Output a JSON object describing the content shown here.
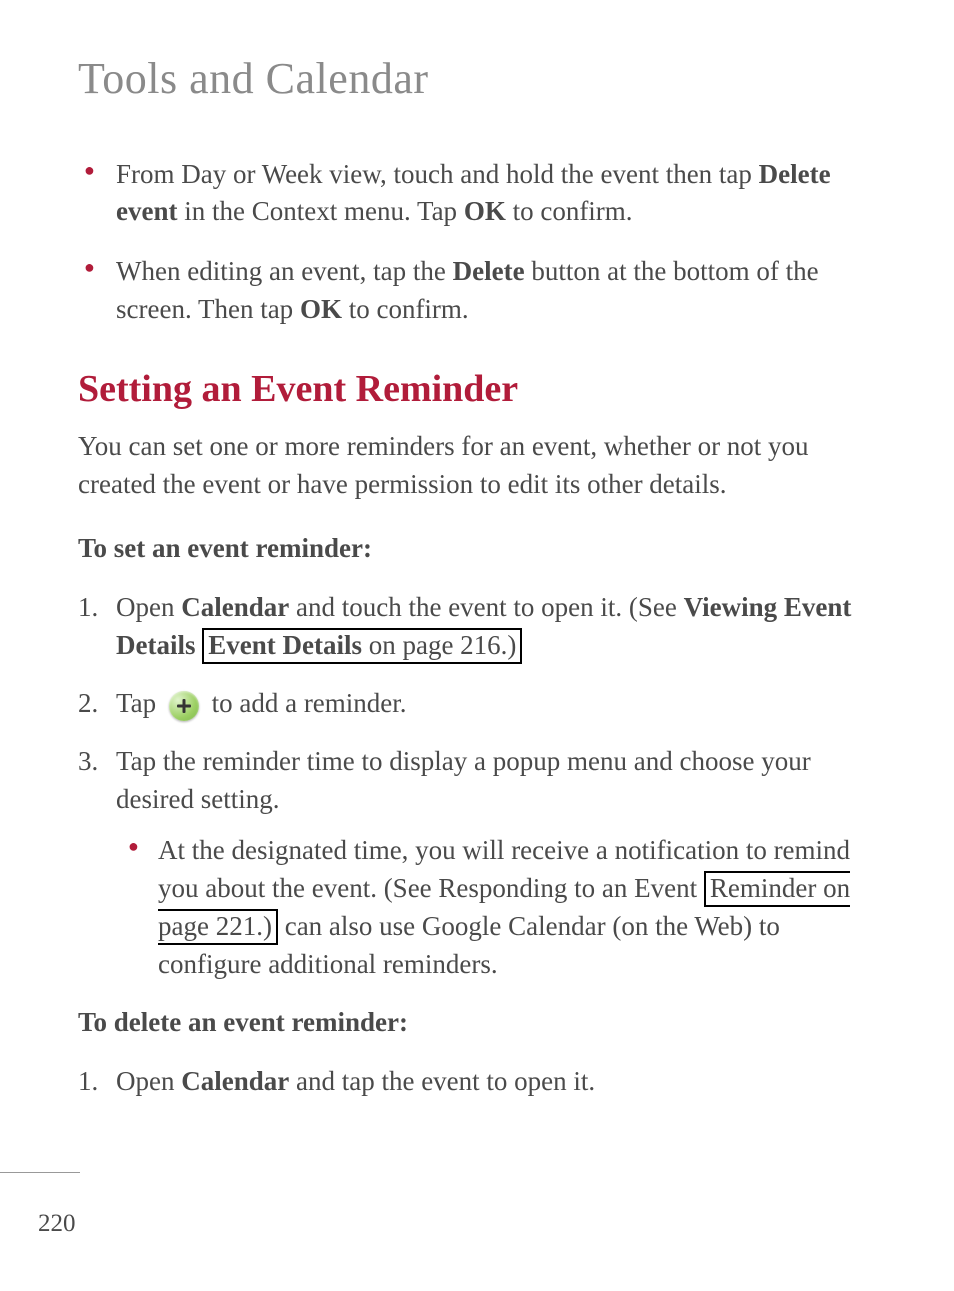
{
  "chapter_title": "Tools and Calendar",
  "top_bullets": [
    {
      "pre": "From Day or Week view, touch and hold the event then tap ",
      "bold1": "Delete event",
      "mid": " in the Context menu. Tap ",
      "bold2": "OK",
      "post": " to confirm."
    },
    {
      "pre": "When editing an event, tap the ",
      "bold1": "Delete",
      "mid": " button at the bottom of the screen. Then tap ",
      "bold2": "OK",
      "post": " to confirm."
    }
  ],
  "section_heading": "Setting an Event Reminder",
  "intro_para": "You can set one or more reminders for an event, whether or not you created the event or have permission to edit its other details.",
  "sub_set": "To set an event reminder:",
  "steps_set": {
    "s1": {
      "num": "1.",
      "pre": "Open ",
      "bold": "Calendar",
      "mid": " and touch the event to open it. (See ",
      "link_bold": "Viewing Event Details",
      "link_rest": " on page 216.)"
    },
    "s2": {
      "num": "2.",
      "pre": "Tap ",
      "post": " to add a reminder."
    },
    "s3": {
      "num": "3.",
      "text": "Tap the reminder time to display a popup menu and choose your desired setting.",
      "inner": {
        "pre": "At the designated time, you will receive a notification to remind you about the event. (See Responding to an Event ",
        "link": "Reminder on page 221.)",
        "post": " can also use Google Calendar (on the Web) to configure additional reminders."
      }
    }
  },
  "sub_delete": "To delete an event reminder:",
  "steps_delete": {
    "s1": {
      "num": "1.",
      "pre": "Open ",
      "bold": "Calendar",
      "post": " and tap the event to open it."
    }
  },
  "page_number": "220"
}
